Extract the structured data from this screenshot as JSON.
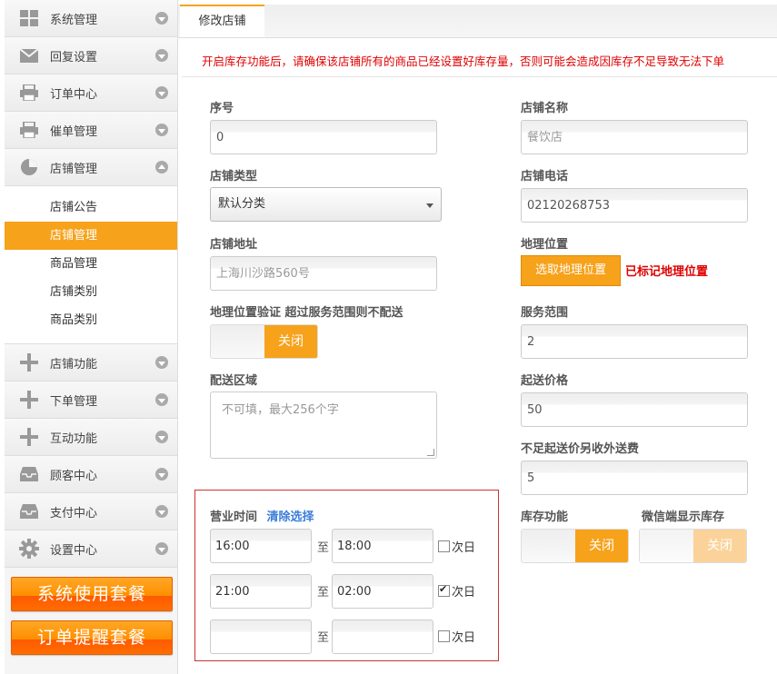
{
  "sidebar": {
    "items": [
      {
        "label": "系统管理",
        "icon": "grid-icon"
      },
      {
        "label": "回复设置",
        "icon": "mail-icon"
      },
      {
        "label": "订单中心",
        "icon": "printer-icon"
      },
      {
        "label": "催单管理",
        "icon": "printer-icon"
      },
      {
        "label": "店铺管理",
        "icon": "pie-chart-icon"
      }
    ],
    "submenu": [
      "店铺公告",
      "店铺管理",
      "商品管理",
      "店铺类别",
      "商品类别"
    ],
    "submenu_active": "店铺管理",
    "items2": [
      {
        "label": "店铺功能",
        "icon": "plus-icon"
      },
      {
        "label": "下单管理",
        "icon": "plus-icon"
      },
      {
        "label": "互动功能",
        "icon": "plus-icon"
      },
      {
        "label": "顾客中心",
        "icon": "inbox-icon"
      },
      {
        "label": "支付中心",
        "icon": "inbox-icon"
      },
      {
        "label": "设置中心",
        "icon": "gear-icon"
      }
    ],
    "package_buttons": [
      "系统使用套餐",
      "订单提醒套餐"
    ]
  },
  "tabs": {
    "active": "修改店铺"
  },
  "notice": "开启库存功能后，请确保该店铺所有的商品已经设置好库存量，否则可能会造成因库存不足导致无法下单",
  "form": {
    "seq_label": "序号",
    "seq_value": "0",
    "name_label": "店铺名称",
    "name_value": "餐饮店",
    "type_label": "店铺类型",
    "type_value": "默认分类",
    "phone_label": "店铺电话",
    "phone_value": "02120268753",
    "addr_label": "店铺地址",
    "addr_value": "上海川沙路560号",
    "geo_label": "地理位置",
    "geo_button": "选取地理位置",
    "geo_status": "已标记地理位置",
    "geo_verify_label": "地理位置验证 超过服务范围则不配送",
    "geo_verify_toggle": "关闭",
    "range_label": "服务范围",
    "range_value": "2",
    "area_label": "配送区域",
    "area_placeholder": "不可填，最大256个字",
    "min_price_label": "起送价格",
    "min_price_value": "50",
    "extra_fee_label": "不足起送价另收外送费",
    "extra_fee_value": "5",
    "stock_label": "库存功能",
    "stock_toggle": "关闭",
    "wx_stock_label": "微信端显示库存",
    "wx_stock_toggle": "关闭",
    "hours_label": "营业时间",
    "hours_clear": "清除选择",
    "hours_to": "至",
    "next_day": "次日",
    "hours": [
      {
        "start": "16:00",
        "end": "18:00",
        "next_day": false
      },
      {
        "start": "21:00",
        "end": "02:00",
        "next_day": true
      },
      {
        "start": "",
        "end": "",
        "next_day": false
      }
    ]
  },
  "colors": {
    "accent": "#f7a21b",
    "danger": "#e00000",
    "link": "#3b7dd8"
  }
}
